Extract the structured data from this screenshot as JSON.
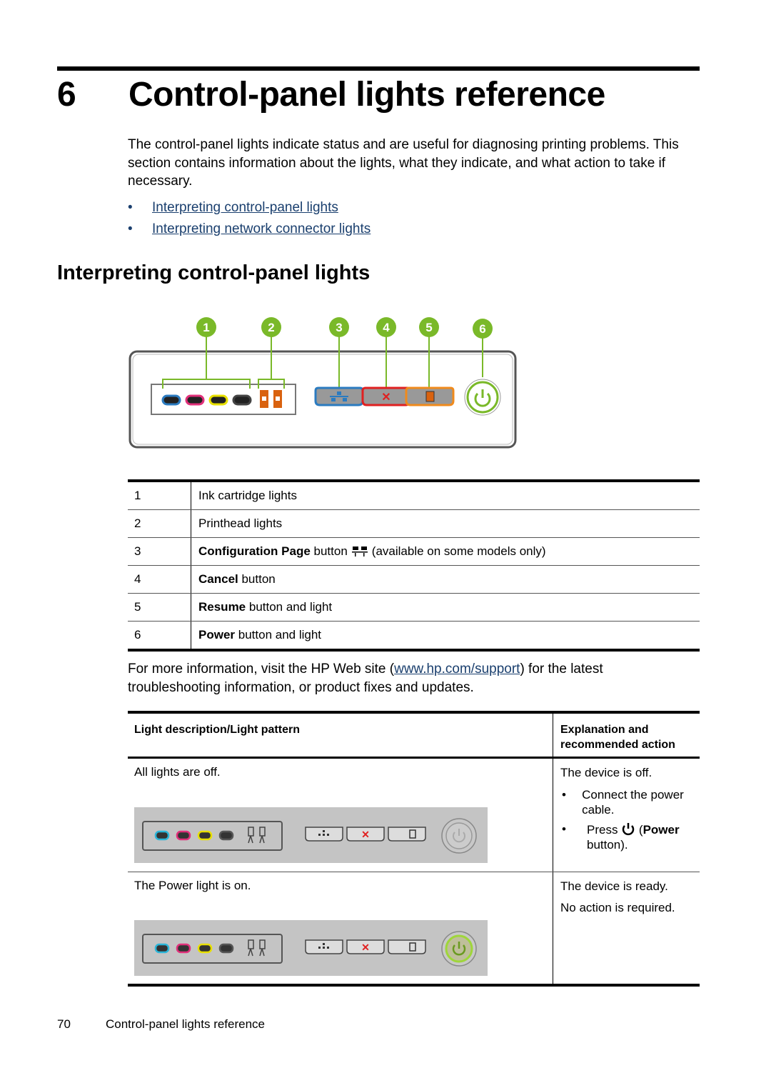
{
  "chapter": {
    "number": "6",
    "title": "Control-panel lights reference",
    "intro": "The control-panel lights indicate status and are useful for diagnosing printing problems. This section contains information about the lights, what they indicate, and what action to take if necessary.",
    "links": [
      {
        "label": "Interpreting control-panel lights"
      },
      {
        "label": "Interpreting network connector lights"
      }
    ]
  },
  "section": {
    "title": "Interpreting control-panel lights",
    "figure": {
      "callouts": [
        "1",
        "2",
        "3",
        "4",
        "5",
        "6"
      ],
      "colors": {
        "callout": "#7ab929",
        "cyan": "#2b7bc0",
        "magenta": "#e0307a",
        "yellow": "#e8e000",
        "black": "#222222",
        "printhead": "#d9620f",
        "config": "#2b7bc0",
        "cancel": "#e02020",
        "resume": "#f08a1c",
        "power": "#7ab929"
      }
    },
    "legend_table": [
      {
        "num": "1",
        "bold": "",
        "text": "Ink cartridge lights"
      },
      {
        "num": "2",
        "bold": "",
        "text": "Printhead lights"
      },
      {
        "num": "3",
        "bold": "Configuration Page",
        "text": " button",
        "after": "(available on some models only)"
      },
      {
        "num": "4",
        "bold": "Cancel",
        "text": " button"
      },
      {
        "num": "5",
        "bold": "Resume",
        "text": " button and light"
      },
      {
        "num": "6",
        "bold": "Power",
        "text": " button and light"
      }
    ],
    "more_info": {
      "before": "For more information, visit the HP Web site (",
      "link": "www.hp.com/support",
      "after": ") for the latest troubleshooting information, or product fixes and updates."
    },
    "lights_table": {
      "headers": [
        "Light description/Light pattern",
        "Explanation and recommended action"
      ],
      "rows": [
        {
          "description": "All lights are off.",
          "power_on": false,
          "explanation": "The device is off.",
          "bullets": [
            "Connect the power cable."
          ],
          "press": {
            "prefix": "Press ",
            "bold": "Power",
            "open": " (",
            "close": "button)."
          }
        },
        {
          "description": "The Power light is on.",
          "power_on": true,
          "explanation": "The device is ready.",
          "extra": "No action is required."
        }
      ]
    }
  },
  "footer": {
    "page_number": "70",
    "chapter_title": "Control-panel lights reference"
  }
}
